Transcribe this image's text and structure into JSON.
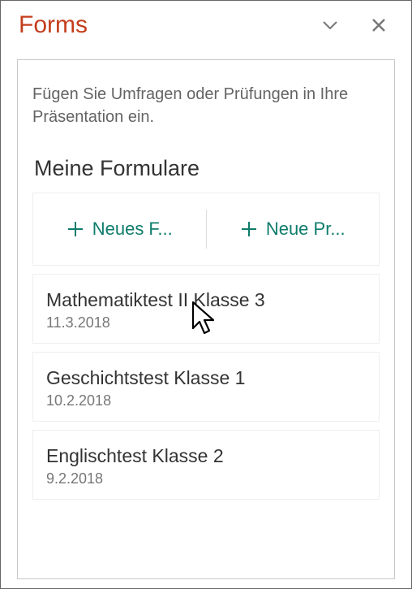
{
  "header": {
    "title": "Forms"
  },
  "panel": {
    "intro": "Fügen Sie Umfragen oder Prüfungen in Ihre Präsentation ein.",
    "section_title": "Meine Formulare",
    "new_form_label": "Neues F...",
    "new_quiz_label": "Neue Pr..."
  },
  "forms": [
    {
      "name": "Mathematiktest II Klasse 3",
      "date": "11.3.2018"
    },
    {
      "name": "Geschichtstest Klasse 1",
      "date": "10.2.2018"
    },
    {
      "name": "Englischtest Klasse 2",
      "date": "9.2.2018"
    }
  ]
}
